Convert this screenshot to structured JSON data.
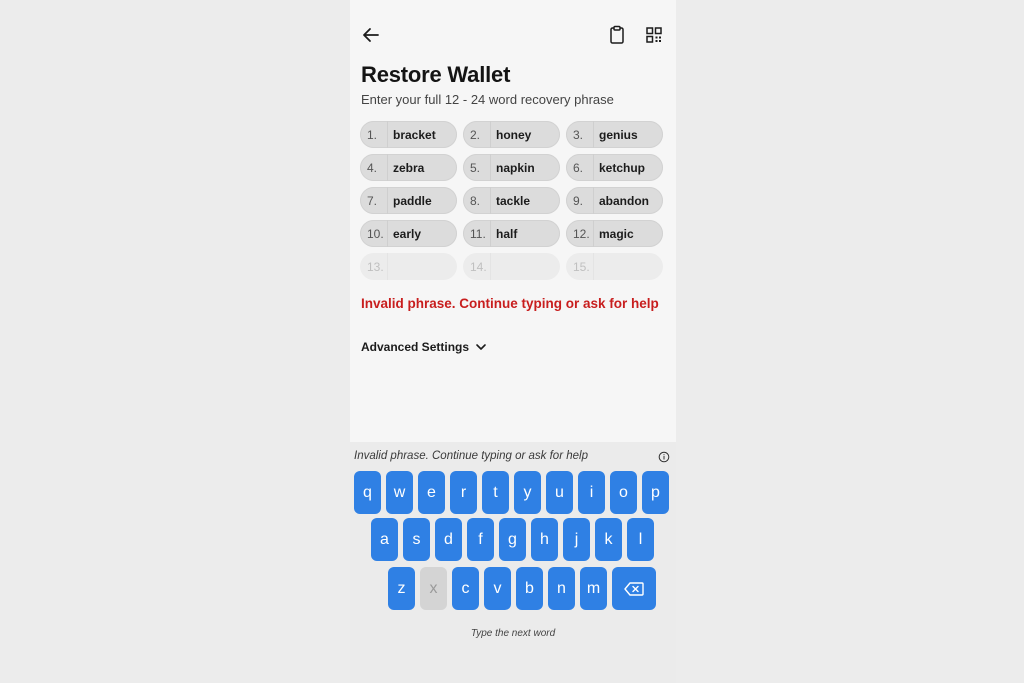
{
  "header": {
    "title": "Restore Wallet",
    "subtitle": "Enter your full 12 - 24 word recovery phrase"
  },
  "icons": {
    "back": "arrow-left-icon",
    "paste": "clipboard-icon",
    "scan": "qr-code-icon"
  },
  "words": [
    {
      "num": "1.",
      "word": "bracket"
    },
    {
      "num": "2.",
      "word": "honey"
    },
    {
      "num": "3.",
      "word": "genius"
    },
    {
      "num": "4.",
      "word": "zebra"
    },
    {
      "num": "5.",
      "word": "napkin"
    },
    {
      "num": "6.",
      "word": "ketchup"
    },
    {
      "num": "7.",
      "word": "paddle"
    },
    {
      "num": "8.",
      "word": "tackle"
    },
    {
      "num": "9.",
      "word": "abandon"
    },
    {
      "num": "10.",
      "word": "early"
    },
    {
      "num": "11.",
      "word": "half"
    },
    {
      "num": "12.",
      "word": "magic"
    },
    {
      "num": "13.",
      "word": ""
    },
    {
      "num": "14.",
      "word": ""
    },
    {
      "num": "15.",
      "word": ""
    }
  ],
  "error_message": "Invalid phrase. Continue typing or ask for help",
  "advanced_settings_label": "Advanced Settings",
  "keyboard": {
    "hint": "Invalid phrase. Continue typing or ask for help",
    "footer": "Type the next word",
    "row1": [
      "q",
      "w",
      "e",
      "r",
      "t",
      "y",
      "u",
      "i",
      "o",
      "p"
    ],
    "row2": [
      "a",
      "s",
      "d",
      "f",
      "g",
      "h",
      "j",
      "k",
      "l"
    ],
    "row3": [
      "z",
      "x",
      "c",
      "v",
      "b",
      "n",
      "m"
    ],
    "disabled_keys": [
      "x"
    ]
  },
  "colors": {
    "accent": "#2f80e4",
    "error": "#c81e1e",
    "chip": "#dcdcdc"
  }
}
